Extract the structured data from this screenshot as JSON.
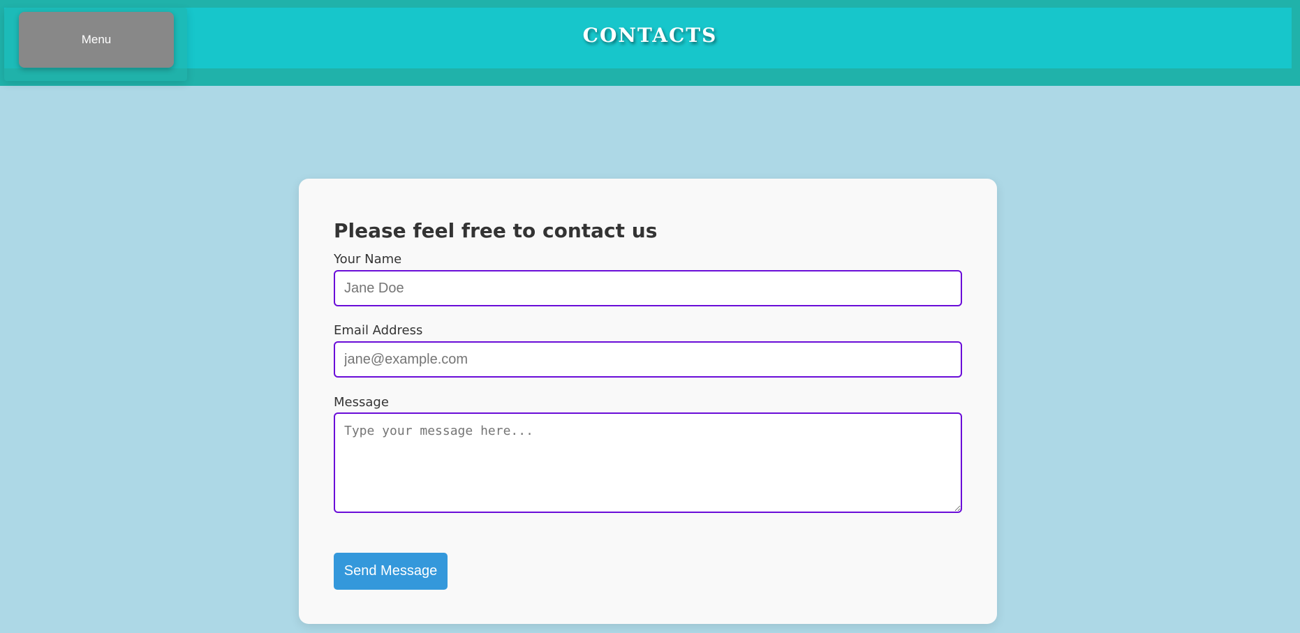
{
  "header": {
    "title": "CONTACTS",
    "menu_label": "Menu"
  },
  "form": {
    "heading": "Please feel free to contact us",
    "name": {
      "label": "Your Name",
      "placeholder": "Jane Doe",
      "value": ""
    },
    "email": {
      "label": "Email Address",
      "placeholder": "jane@example.com",
      "value": ""
    },
    "message": {
      "label": "Message",
      "placeholder": "Type your message here...",
      "value": ""
    },
    "submit_label": "Send Message"
  },
  "colors": {
    "page_background": "#add8e6",
    "header_outer": "#20b2aa",
    "header_inner": "#17c6cb",
    "menu_button": "#888888",
    "input_border": "#6a0dd8",
    "submit_button": "#3498db",
    "card_background": "#f9f9f9"
  }
}
